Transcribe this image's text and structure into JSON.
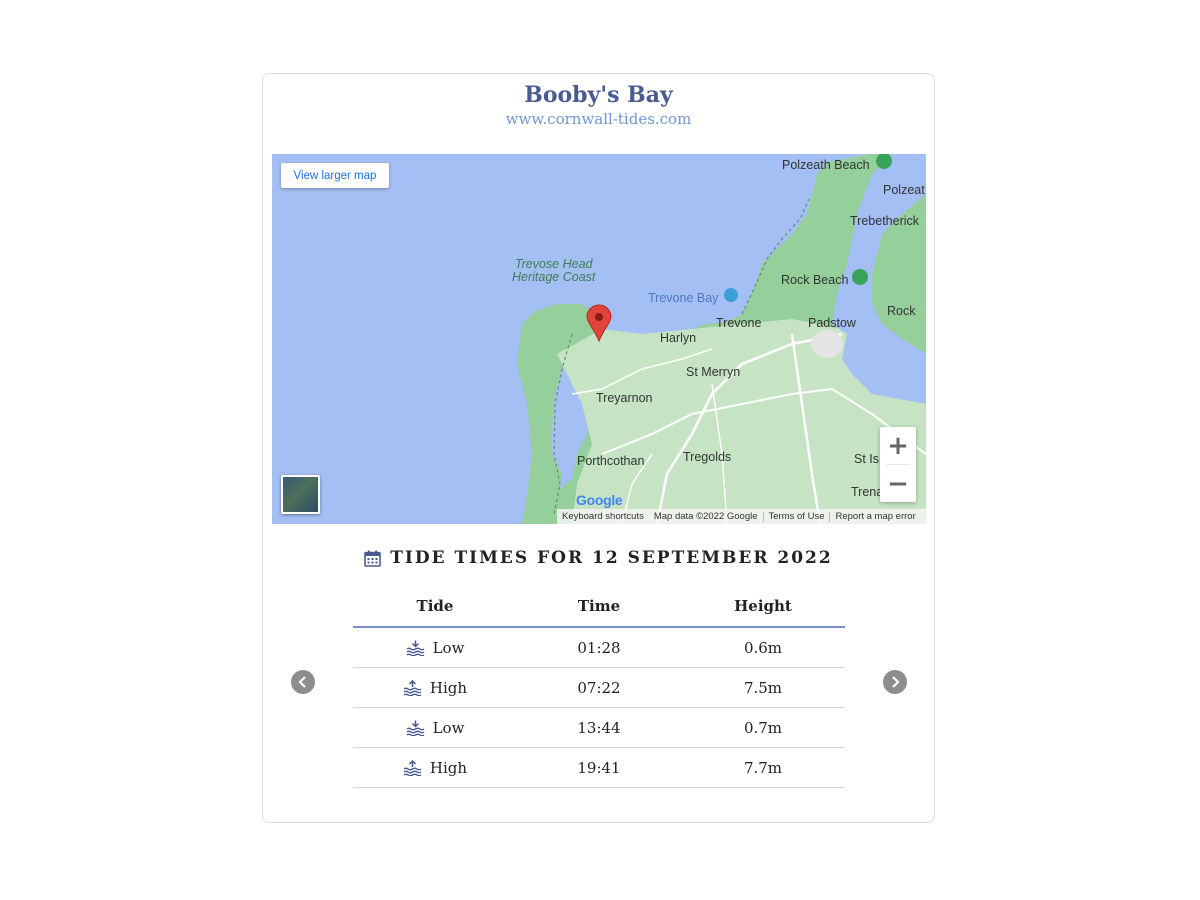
{
  "header": {
    "title": "Booby's Bay",
    "subtitle": "www.cornwall-tides.com"
  },
  "map": {
    "view_larger_label": "View larger map",
    "zoom_in_label": "+",
    "zoom_out_label": "−",
    "labels": {
      "polzeath_beach": "Polzeath Beach",
      "polzeat": "Polzeat",
      "trebetherick": "Trebetherick",
      "trevose_head_line1": "Trevose Head",
      "trevose_head_line2": "Heritage Coast",
      "trevone_bay": "Trevone Bay",
      "rock_beach": "Rock Beach",
      "rock": "Rock",
      "trevone": "Trevone",
      "padstow": "Padstow",
      "harlyn": "Harlyn",
      "st_merryn": "St Merryn",
      "treyarnon": "Treyarnon",
      "porthcothan": "Porthcothan",
      "tregolds": "Tregolds",
      "st_is": "St Is",
      "trena": "Trena"
    },
    "google_logo": "Google",
    "footer": {
      "keyboard_shortcuts": "Keyboard shortcuts",
      "map_data": "Map data ©2022 Google",
      "terms": "Terms of Use",
      "report": "Report a map error"
    },
    "colors": {
      "water": "#a4bff3",
      "land": "#95cf9b",
      "land_light": "#c6e4c4",
      "road": "#ffffff",
      "marker": "#e0443a"
    }
  },
  "tide_section": {
    "title": "TIDE TIMES FOR 12 SEPTEMBER 2022",
    "icon": "calendar-icon",
    "columns": [
      "Tide",
      "Time",
      "Height"
    ],
    "rows": [
      {
        "tide": "Low",
        "icon": "low-tide-icon",
        "time": "01:28",
        "height": "0.6m"
      },
      {
        "tide": "High",
        "icon": "high-tide-icon",
        "time": "07:22",
        "height": "7.5m"
      },
      {
        "tide": "Low",
        "icon": "low-tide-icon",
        "time": "13:44",
        "height": "0.7m"
      },
      {
        "tide": "High",
        "icon": "high-tide-icon",
        "time": "19:41",
        "height": "7.7m"
      }
    ],
    "accent_color": "#7b8fcf"
  }
}
